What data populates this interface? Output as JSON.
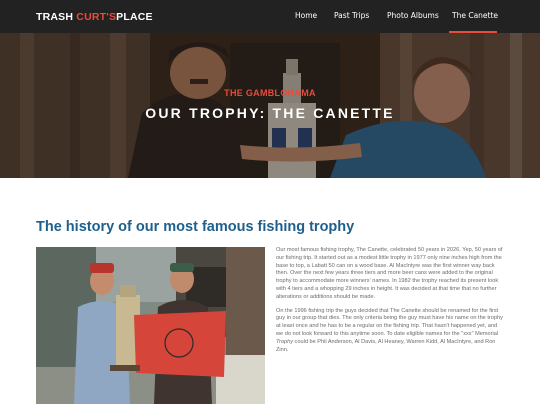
{
  "header": {
    "logo_part1": "TRASH ",
    "logo_part2": "CURT'S",
    "logo_part3": "PLACE",
    "nav": [
      {
        "label": "Home"
      },
      {
        "label": "Past Trips"
      },
      {
        "label": "Photo Albums"
      },
      {
        "label": "The Canette",
        "active": true
      }
    ]
  },
  "hero": {
    "kicker": "THE GAMBLORAMA",
    "title": "OUR TROPHY: THE CANETTE"
  },
  "main": {
    "section_title": "The history of our most famous fishing trophy",
    "p1": "Our most famous fishing trophy, The Canette, celebrated 50 years in 2026. Yep, 50 years of our fishing trip. It started out as a modest little trophy in 1977 only nine inches high from the base to top, a Labatt 50 can on a wood base. Al MacIntyre was the first winner way back then. Over the next few years three tiers and more beer cans were added to the original trophy to accommodate more winners' names. In 1982 the trophy reached its present look with 4 tiers and a whopping 29 inches in height. It was decided at that time that no further alterations or additions should be made.",
    "p2_start": "On the 1996 fishing trip the guys decided that The Canette should be renamed for the first guy in our group that dies. The only criteria being the guy must have his name on the trophy at least once and he has to be a regular on the fishing trip. That hasn't happened yet, and we do not look forward to this anytime soon. To date eligible names for the \"xxx\" Memorial ",
    "p2_italic": "Trophy",
    "p2_end": " could be Phil Anderson, Al Davis, Al Heaney, Warren Kidd, Al MacIntyre, and Ron Zinn."
  },
  "colors": {
    "accent": "#e84c3d",
    "header_bg": "#222222",
    "heading_blue": "#1f5f8b",
    "body_text": "#6b6b6b"
  }
}
